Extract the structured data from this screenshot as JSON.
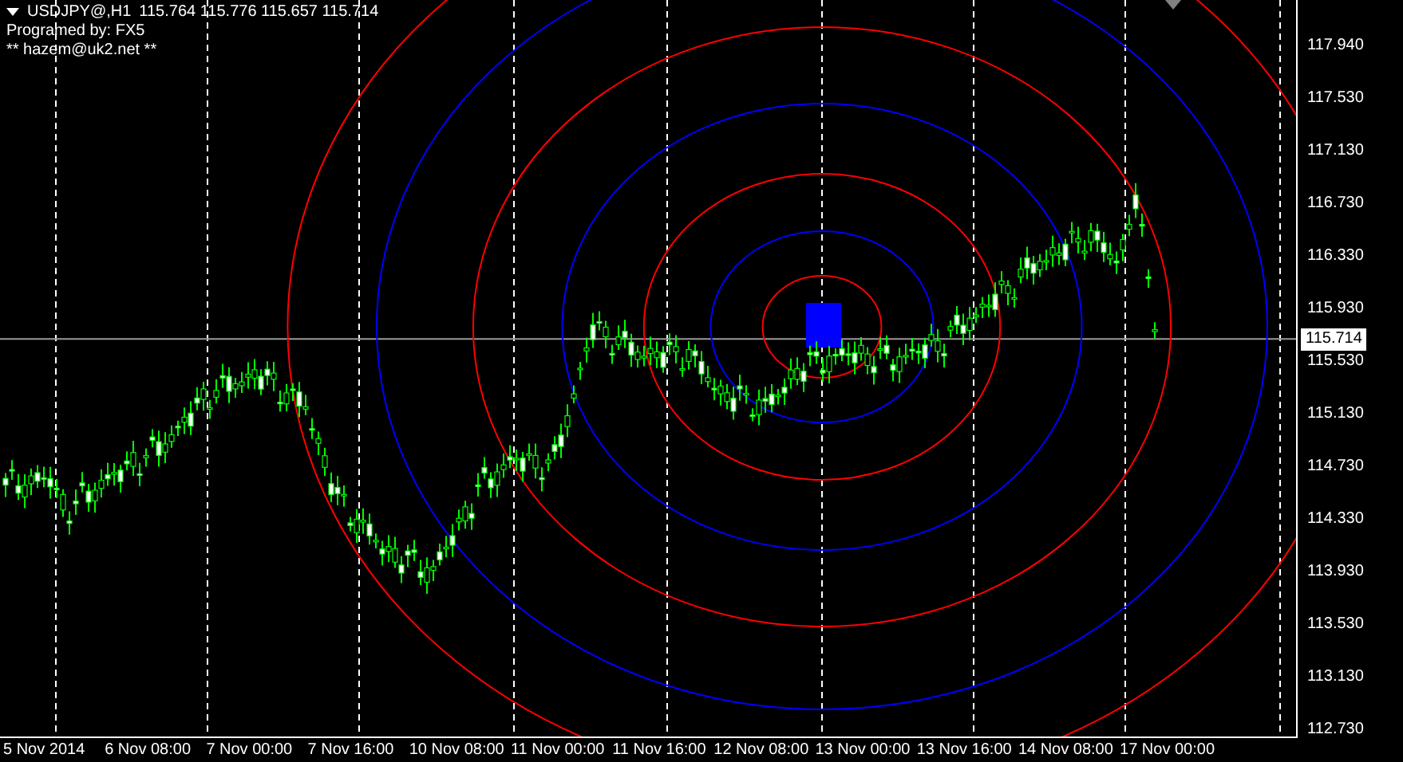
{
  "symbol_header": {
    "symbol": "USDJPY@,H1",
    "ohlc": "115.764 115.776 115.657 115.714"
  },
  "info_lines": [
    "Programed by: FX5",
    "** hazem@uk2.net **"
  ],
  "price_axis": {
    "labels": [
      "117.940",
      "117.530",
      "117.130",
      "116.730",
      "116.330",
      "115.930",
      "115.530",
      "115.130",
      "114.730",
      "114.330",
      "113.930",
      "113.530",
      "113.130",
      "112.730"
    ],
    "current_price": "115.714"
  },
  "time_axis": {
    "labels": [
      "5 Nov 2014",
      "6 Nov 08:00",
      "7 Nov 00:00",
      "7 Nov 16:00",
      "10 Nov 08:00",
      "11 Nov 00:00",
      "11 Nov 16:00",
      "12 Nov 08:00",
      "13 Nov 00:00",
      "13 Nov 16:00",
      "14 Nov 08:00",
      "17 Nov 00:00"
    ]
  }
}
